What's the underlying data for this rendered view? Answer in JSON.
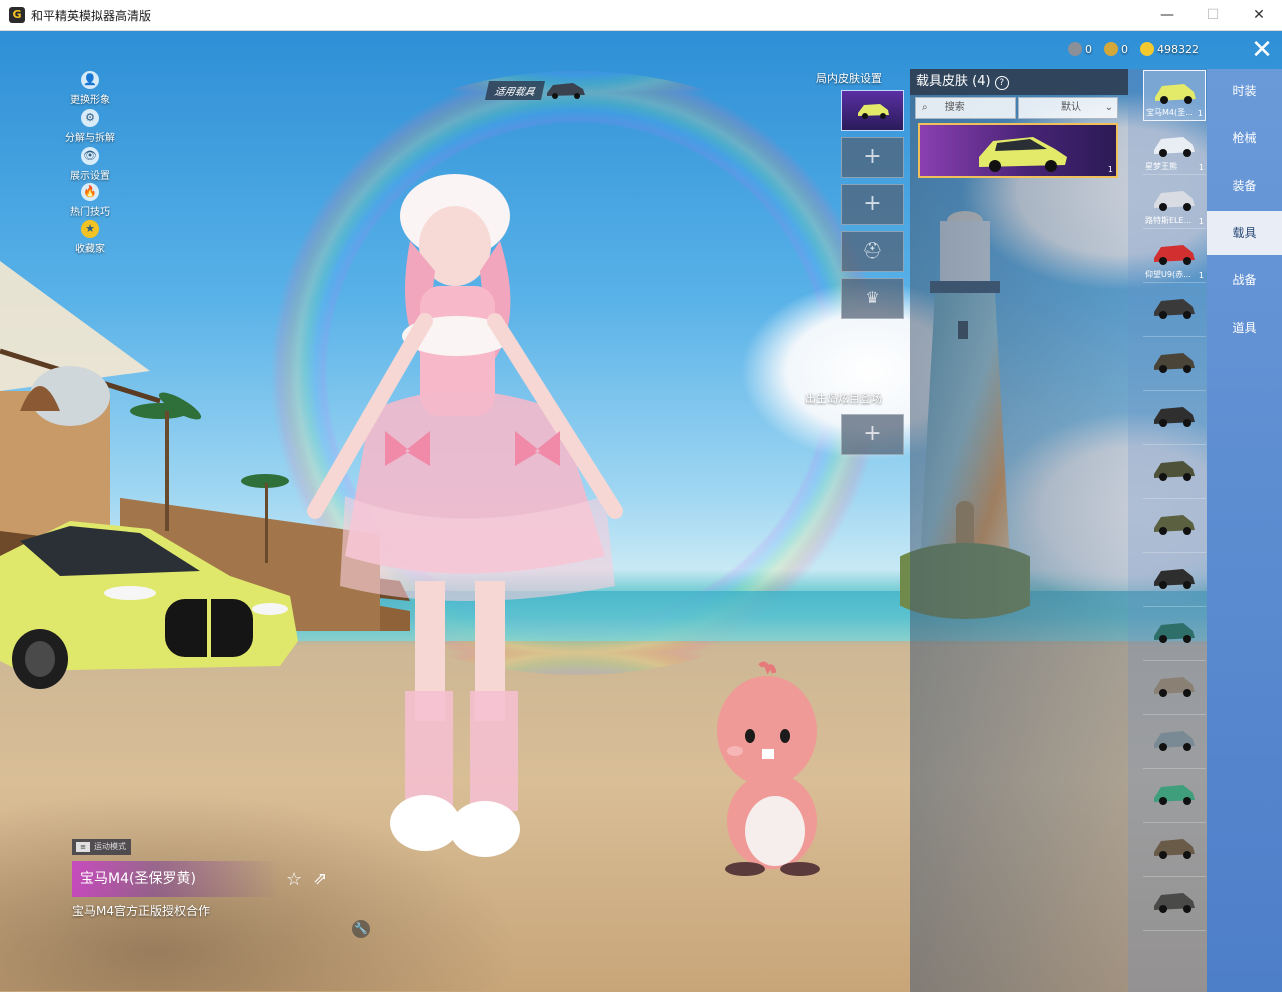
{
  "window": {
    "title": "和平精英模拟器高清版",
    "logo_letter": "G",
    "controls": {
      "minimize": "—",
      "maximize": "☐",
      "close": "✕"
    }
  },
  "left_menu": [
    {
      "label": "更换形象",
      "icon": "person-icon",
      "glyph": "👤"
    },
    {
      "label": "分解与拆解",
      "icon": "split-icon",
      "glyph": "⚙"
    },
    {
      "label": "展示设置",
      "icon": "eye-icon",
      "glyph": "👁"
    },
    {
      "label": "热门技巧",
      "icon": "flame-icon",
      "glyph": "🔥"
    },
    {
      "label": "收藏家",
      "icon": "badge-icon",
      "glyph": "★"
    }
  ],
  "vehicle_tag": "适用载具",
  "currency": {
    "coin1_value": "0",
    "coin2_value": "0",
    "coin3_value": "498322",
    "colors": [
      "#8a8f98",
      "#d4a73a",
      "#f5c930"
    ]
  },
  "slots": {
    "title": "局内皮肤设置",
    "plus": "+",
    "spawn_title": "出生岛炫目登场"
  },
  "skin_panel": {
    "title": "载具皮肤 (4)",
    "help_glyph": "?",
    "search_placeholder": "搜索",
    "sort_label": "默认",
    "card_count": "1"
  },
  "thumbnails": [
    {
      "label": "宝马M4(圣...",
      "count": "1"
    },
    {
      "label": "星梦王熊",
      "count": "1"
    },
    {
      "label": "路特斯ELE...",
      "count": "1"
    },
    {
      "label": "仰望U9(赤...",
      "count": "1"
    },
    {
      "label": "",
      "count": ""
    },
    {
      "label": "",
      "count": ""
    },
    {
      "label": "",
      "count": ""
    },
    {
      "label": "",
      "count": ""
    },
    {
      "label": "",
      "count": ""
    },
    {
      "label": "",
      "count": ""
    },
    {
      "label": "",
      "count": ""
    },
    {
      "label": "",
      "count": ""
    },
    {
      "label": "",
      "count": ""
    },
    {
      "label": "",
      "count": ""
    },
    {
      "label": "",
      "count": ""
    },
    {
      "label": "",
      "count": ""
    }
  ],
  "categories": [
    {
      "label": "时装",
      "active": false
    },
    {
      "label": "枪械",
      "active": false
    },
    {
      "label": "装备",
      "active": false
    },
    {
      "label": "载具",
      "active": true
    },
    {
      "label": "战备",
      "active": false
    },
    {
      "label": "道具",
      "active": false
    }
  ],
  "close_glyph": "✕",
  "info": {
    "mode_badge": "运动模式",
    "car_name": "宝马M4(圣保罗黄)",
    "car_desc": "宝马M4官方正版授权合作",
    "fav_glyph": "☆",
    "share_glyph": "⇗",
    "wrench_glyph": "🔧"
  }
}
